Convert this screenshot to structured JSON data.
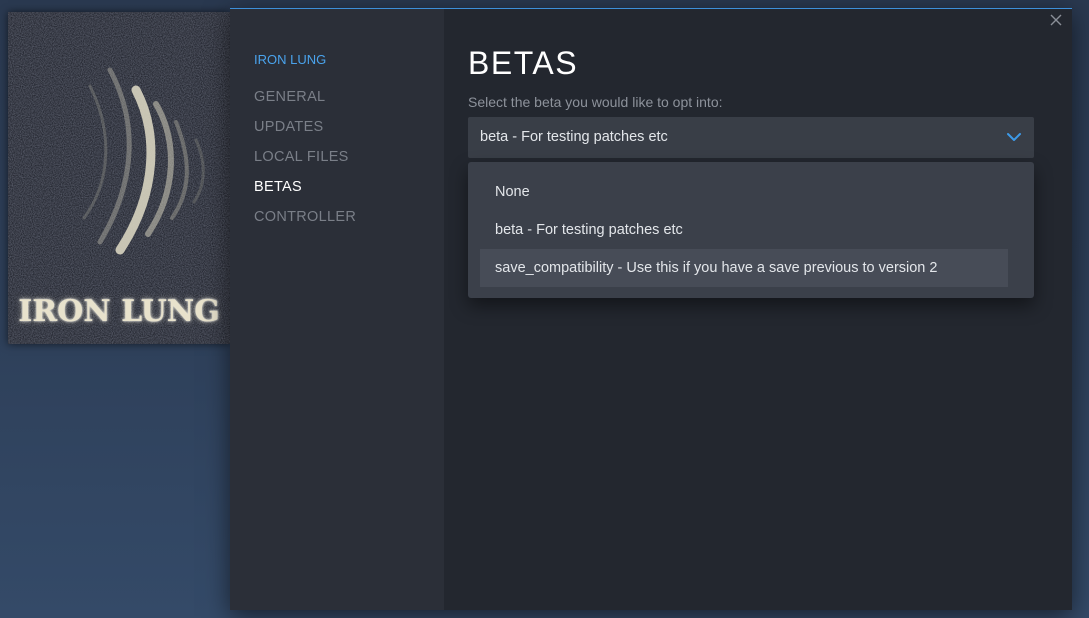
{
  "capsule": {
    "title": "IRON LUNG"
  },
  "sidebar": {
    "game_name": "IRON LUNG",
    "items": [
      {
        "label": "GENERAL",
        "active": false
      },
      {
        "label": "UPDATES",
        "active": false
      },
      {
        "label": "LOCAL FILES",
        "active": false
      },
      {
        "label": "BETAS",
        "active": true
      },
      {
        "label": "CONTROLLER",
        "active": false
      }
    ]
  },
  "main": {
    "title": "BETAS",
    "subtitle": "Select the beta you would like to opt into:",
    "select": {
      "value": "beta - For testing patches etc",
      "options": [
        "None",
        "beta - For testing patches etc",
        "save_compatibility - Use this if you have a save previous to version 2"
      ]
    }
  },
  "icons": {
    "close": "close-icon",
    "chevron": "chevron-down-icon"
  },
  "colors": {
    "accent": "#4aa3ec",
    "dialog_bg": "#23272f",
    "sidebar_bg": "#2b2f38",
    "select_bg": "#393e47"
  }
}
